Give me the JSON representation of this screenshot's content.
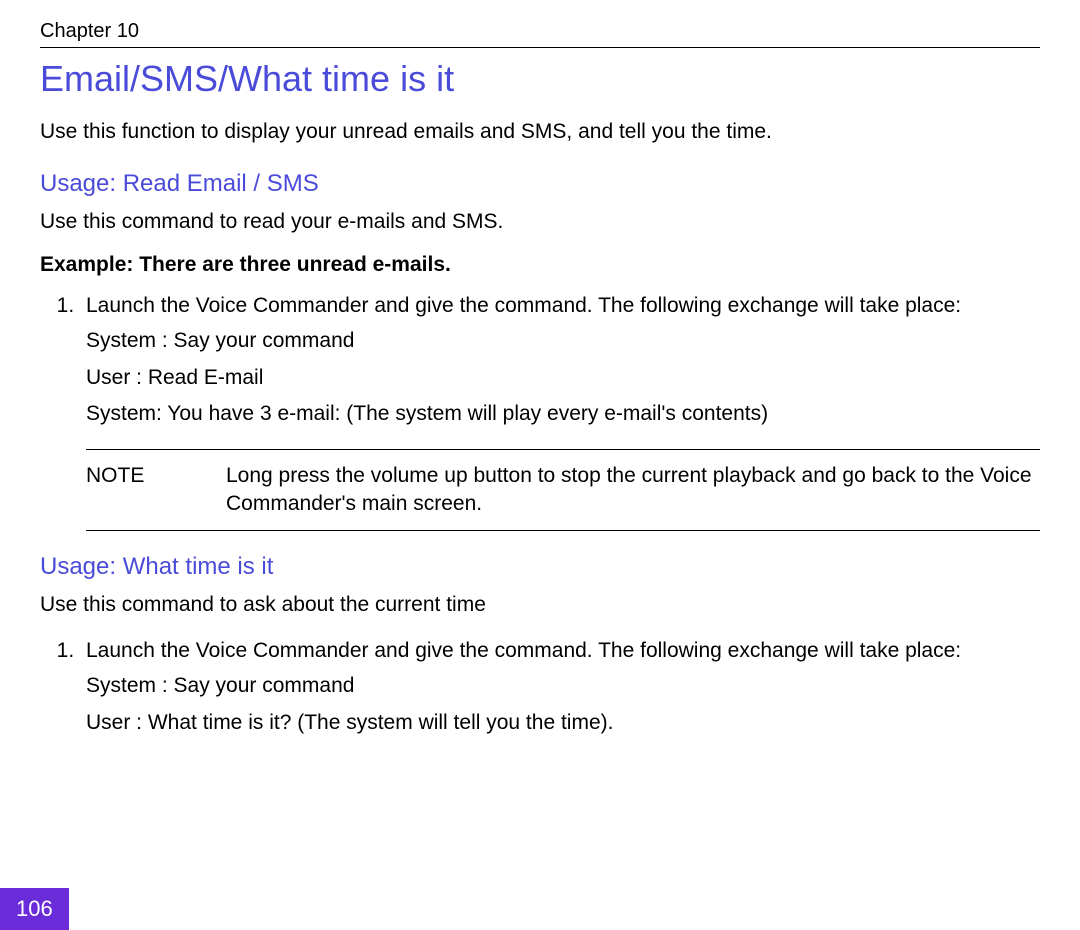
{
  "chapter": "Chapter 10",
  "section_title": "Email/SMS/What time is it",
  "intro": "Use this function to display your unread emails and SMS, and tell you the time.",
  "sub1": {
    "title": "Usage: Read Email / SMS",
    "desc": "Use this command to read your e-mails and SMS.",
    "example": "Example: There are three unread e-mails.",
    "step1": "Launch the Voice Commander and give the command. The following exchange will take place:",
    "dlg_sys": "System :  Say your command",
    "dlg_usr": "User :  Read E-mail",
    "dlg_sys2": "System:  You have 3 e-mail: (The system will play every e-mail's contents)",
    "note_label": "NOTE",
    "note_text": "Long press the volume up button to stop the current playback and go back to the Voice Commander's main screen."
  },
  "sub2": {
    "title": "Usage: What time is it",
    "desc": "Use this command to ask about the current time",
    "step1": "Launch the Voice Commander and give the command. The following exchange will take place:",
    "dlg_sys": "System :  Say your command",
    "dlg_usr": "User :  What time is it?  (The system will tell you the time)."
  },
  "page_number": "106"
}
